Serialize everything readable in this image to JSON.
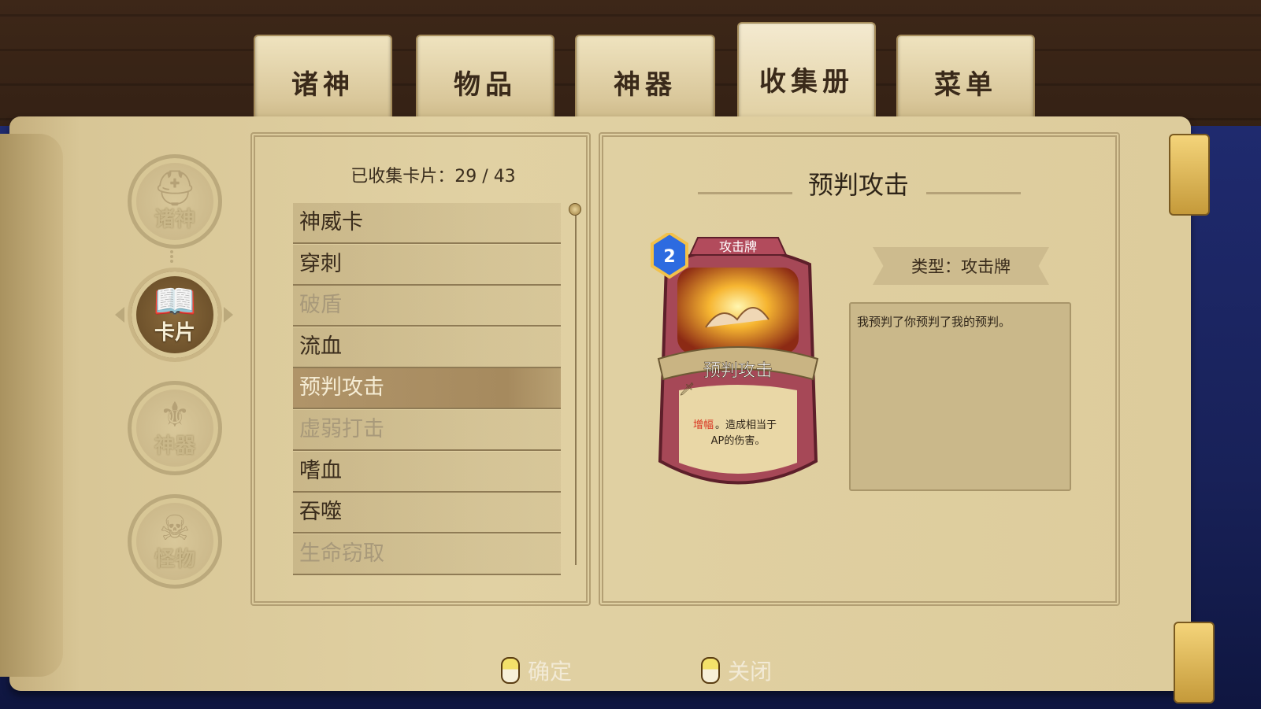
{
  "tabs": [
    {
      "label": "诸神"
    },
    {
      "label": "物品"
    },
    {
      "label": "神器"
    },
    {
      "label": "收集册",
      "active": true
    },
    {
      "label": "菜单"
    }
  ],
  "sidebar": {
    "items": [
      {
        "label": "诸神",
        "icon": "helmet-icon"
      },
      {
        "label": "卡片",
        "icon": "open-book-icon",
        "active": true
      },
      {
        "label": "神器",
        "icon": "artifact-icon"
      },
      {
        "label": "怪物",
        "icon": "monster-skull-icon"
      }
    ]
  },
  "collection": {
    "counter": "已收集卡片：29 / 43"
  },
  "card_list": [
    {
      "label": "神威卡",
      "state": "collected"
    },
    {
      "label": "穿刺",
      "state": "collected"
    },
    {
      "label": "破盾",
      "state": "locked"
    },
    {
      "label": "流血",
      "state": "collected"
    },
    {
      "label": "预判攻击",
      "state": "selected"
    },
    {
      "label": "虚弱打击",
      "state": "locked"
    },
    {
      "label": "嗜血",
      "state": "collected"
    },
    {
      "label": "吞噬",
      "state": "collected"
    },
    {
      "label": "生命窃取",
      "state": "locked"
    }
  ],
  "detail": {
    "title": "预判攻击",
    "type_text": "类型：攻击牌",
    "description": "我预判了你预判了我的预判。",
    "card": {
      "cost": "2",
      "category": "攻击牌",
      "name": "预判攻击",
      "effect_keyword": "增幅",
      "effect_rest_line1": "。造成相当于",
      "effect_line2": "AP的伤害。"
    }
  },
  "footer": {
    "confirm_label": "确定",
    "close_label": "关闭"
  },
  "colors": {
    "keyword_red": "#d8321e",
    "gem_blue": "#2d6be0",
    "card_frame": "#a64857"
  }
}
